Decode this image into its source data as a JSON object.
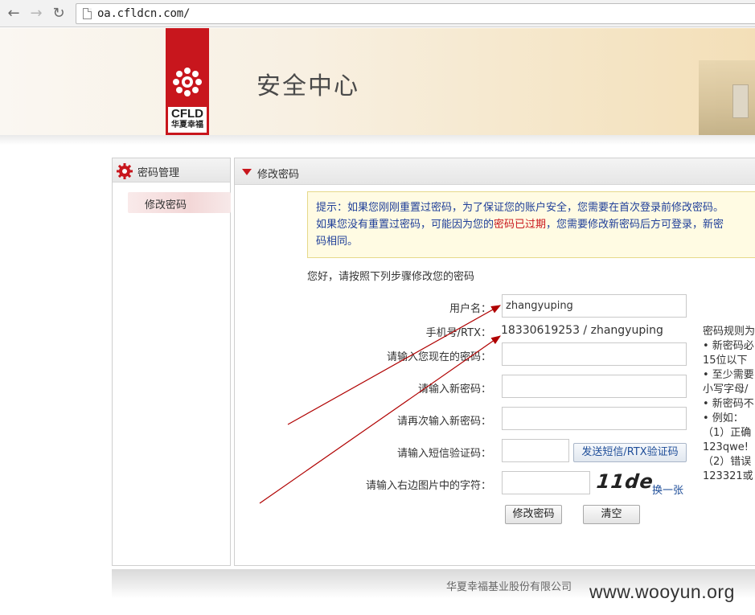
{
  "browser": {
    "url": "oa.cfldcn.com/"
  },
  "header": {
    "logo_text": "CFLD",
    "logo_cn": "华夏幸福",
    "title": "安全中心"
  },
  "sidebar": {
    "section_title": "密码管理",
    "items": [
      {
        "label": "修改密码",
        "active": true
      }
    ]
  },
  "main": {
    "section_title": "修改密码",
    "notice": {
      "line1": "提示：如果您刚刚重置过密码，为了保证您的账户安全，您需要在首次登录前修改密码。",
      "line2_prefix": "如果您没有重置过密码，可能因为您的",
      "line2_warn": "密码已过期",
      "line2_suffix": "，您需要修改新密码后方可登录，新密",
      "line3": "码相同。"
    },
    "greeting": "您好，请按照下列步骤修改您的密码",
    "form": {
      "username_label": "用户名：",
      "username_value": "zhangyuping",
      "mobile_label": "手机号/RTX：",
      "mobile_value": "18330619253 / zhangyuping",
      "current_pw_label": "请输入您现在的密码：",
      "new_pw_label": "请输入新密码：",
      "confirm_pw_label": "请再次输入新密码：",
      "sms_code_label": "请输入短信验证码：",
      "sms_button": "发送短信/RTX验证码",
      "captcha_label": "请输入右边图片中的字符：",
      "captcha_text": "11de",
      "captcha_refresh": "换一张",
      "submit_button": "修改密码",
      "clear_button": "清空"
    },
    "rules": [
      "密码规则为",
      "• 新密码必",
      "15位以下",
      "• 至少需要",
      "小写字母/",
      "• 新密码不",
      "• 例如：",
      "（1）正确",
      "123qwe!",
      "（2）错误",
      "123321或"
    ]
  },
  "footer": {
    "company": "华夏幸福基业股份有限公司",
    "watermark": "www.wooyun.org"
  },
  "colors": {
    "brand_red": "#c8161d",
    "notice_text": "#1f3f99",
    "annotation_arrow": "#b00000"
  }
}
